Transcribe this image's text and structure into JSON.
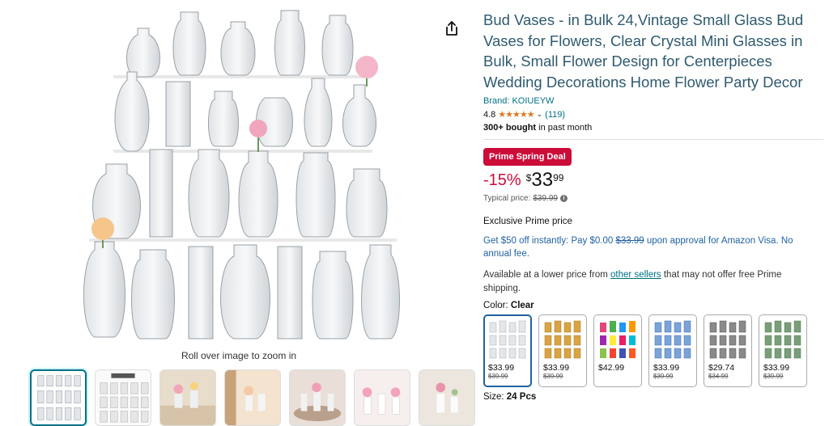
{
  "gallery": {
    "zoom_hint": "Roll over image to zoom in",
    "thumbnail_count": 7
  },
  "product": {
    "title": "Bud Vases - in Bulk 24,Vintage Small Glass Bud Vases for Flowers, Clear Crystal Mini Glasses in Bulk, Small Flower Design for Centerpieces Wedding Decorations Home Flower Party Decor",
    "brand": "Brand: KOIUEYW",
    "rating": "4.8",
    "stars": "★★★★★",
    "review_count": "(119)",
    "bought_bold": "300+ bought",
    "bought_rest": " in past month"
  },
  "pricing": {
    "deal_badge": "Prime Spring Deal",
    "discount": "-15%",
    "currency": "$",
    "price_whole": "33",
    "price_fraction": "99",
    "typical_label": "Typical price:",
    "typical_price": "$39.99",
    "exclusive": "Exclusive Prime price",
    "visa_offer_1": "Get $50 off instantly: Pay $0.00 ",
    "visa_offer_strike": "$33.99",
    "visa_offer_2": " upon approval for Amazon Visa. No annual fee.",
    "lower_1": "Available at a lower price from ",
    "lower_link": "other sellers",
    "lower_2": " that may not offer free Prime shipping."
  },
  "variants": {
    "color_label": "Color:",
    "color_value": "Clear",
    "options": [
      {
        "price": "$33.99",
        "old": "$39.99",
        "accent": "#d8dde2"
      },
      {
        "price": "$33.99",
        "old": "$39.99",
        "accent": "#d9a441"
      },
      {
        "price": "$42.99",
        "old": "",
        "accent": "#e0457b"
      },
      {
        "price": "$33.99",
        "old": "$39.99",
        "accent": "#3f6fb5"
      },
      {
        "price": "$29.74",
        "old": "$34.99",
        "accent": "#6b6b6b"
      },
      {
        "price": "$33.99",
        "old": "$39.99",
        "accent": "#4f7a4f"
      }
    ],
    "size_label": "Size:",
    "size_value": "24 Pcs"
  }
}
